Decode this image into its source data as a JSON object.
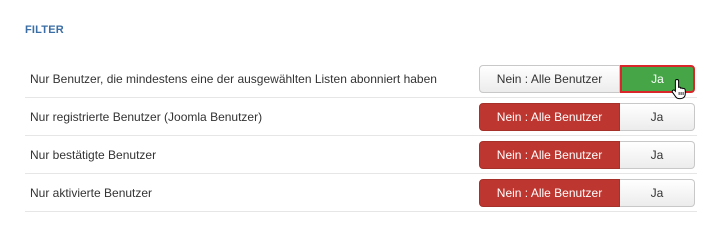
{
  "section": {
    "title": "FILTER"
  },
  "filters": [
    {
      "label": "Nur Benutzer, die mindestens eine der ausgewählten Listen abonniert haben",
      "no_label": "Nein : Alle Benutzer",
      "yes_label": "Ja",
      "selected": "yes"
    },
    {
      "label": "Nur registrierte Benutzer (Joomla Benutzer)",
      "no_label": "Nein : Alle Benutzer",
      "yes_label": "Ja",
      "selected": "no"
    },
    {
      "label": "Nur bestätigte Benutzer",
      "no_label": "Nein : Alle Benutzer",
      "yes_label": "Ja",
      "selected": "no"
    },
    {
      "label": "Nur aktivierte Benutzer",
      "no_label": "Nein : Alle Benutzer",
      "yes_label": "Ja",
      "selected": "no"
    }
  ],
  "colors": {
    "title": "#3a6ea5",
    "no_active": "#bd362f",
    "yes_active": "#46a546",
    "focus_border": "#d9262a"
  },
  "icons": {
    "cursor": "hand-pointer-cursor-icon"
  }
}
